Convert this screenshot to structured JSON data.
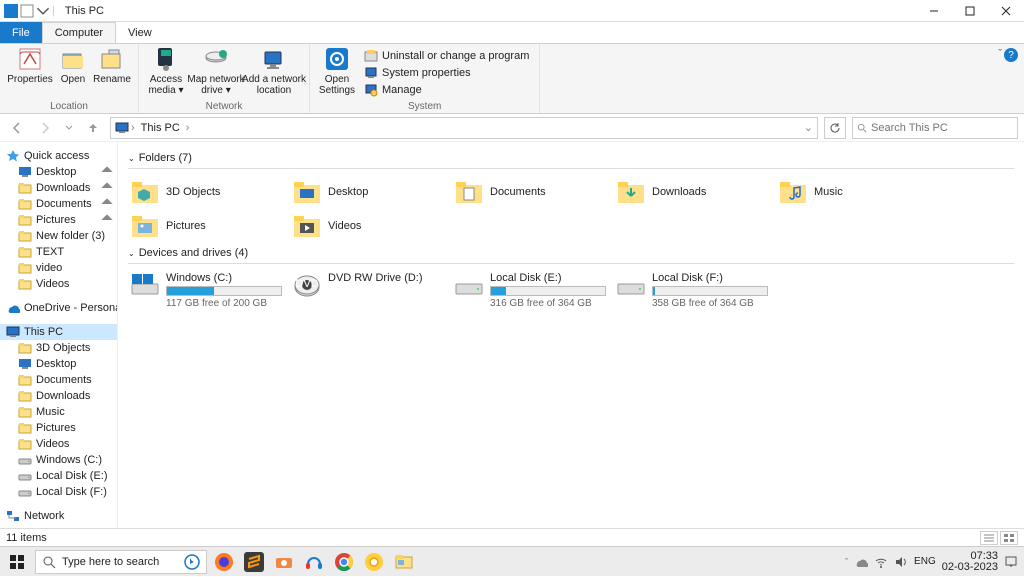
{
  "window_title": "This PC",
  "ribbon": {
    "tabs": [
      "File",
      "Computer",
      "View"
    ],
    "groups": {
      "location": {
        "label": "Location",
        "properties": "Properties",
        "open": "Open",
        "rename": "Rename"
      },
      "network": {
        "label": "Network",
        "access_media": "Access\nmedia ▾",
        "map_drive": "Map network\ndrive ▾",
        "add_location": "Add a network\nlocation"
      },
      "system": {
        "label": "System",
        "open_settings": "Open\nSettings",
        "uninstall": "Uninstall or change a program",
        "sys_props": "System properties",
        "manage": "Manage"
      }
    }
  },
  "breadcrumb": {
    "root": "This PC"
  },
  "search": {
    "placeholder": "Search This PC"
  },
  "sidebar": {
    "quick_access": "Quick access",
    "qa_items": [
      {
        "label": "Desktop",
        "pin": true
      },
      {
        "label": "Downloads",
        "pin": true
      },
      {
        "label": "Documents",
        "pin": true
      },
      {
        "label": "Pictures",
        "pin": true
      },
      {
        "label": "New folder (3)",
        "pin": false
      },
      {
        "label": "TEXT",
        "pin": false
      },
      {
        "label": "video",
        "pin": false
      },
      {
        "label": "Videos",
        "pin": false
      }
    ],
    "onedrive": "OneDrive - Personal",
    "this_pc": "This PC",
    "pc_items": [
      "3D Objects",
      "Desktop",
      "Documents",
      "Downloads",
      "Music",
      "Pictures",
      "Videos",
      "Windows (C:)",
      "Local Disk (E:)",
      "Local Disk (F:)"
    ],
    "network": "Network"
  },
  "sections": {
    "folders_head": "Folders (7)",
    "drives_head": "Devices and drives (4)"
  },
  "folders": [
    {
      "label": "3D Objects"
    },
    {
      "label": "Desktop"
    },
    {
      "label": "Documents"
    },
    {
      "label": "Downloads"
    },
    {
      "label": "Music"
    },
    {
      "label": "Pictures"
    },
    {
      "label": "Videos"
    }
  ],
  "drives": [
    {
      "name": "Windows (C:)",
      "free": "117 GB free of 200 GB",
      "pct": 41
    },
    {
      "name": "DVD RW Drive (D:)",
      "free": "",
      "pct": -1
    },
    {
      "name": "Local Disk (E:)",
      "free": "316 GB free of 364 GB",
      "pct": 13
    },
    {
      "name": "Local Disk (F:)",
      "free": "358 GB free of 364 GB",
      "pct": 2
    }
  ],
  "status": {
    "items": "11 items"
  },
  "taskbar": {
    "search_placeholder": "Type here to search",
    "lang": "ENG",
    "time": "07:33",
    "date": "02-03-2023"
  }
}
